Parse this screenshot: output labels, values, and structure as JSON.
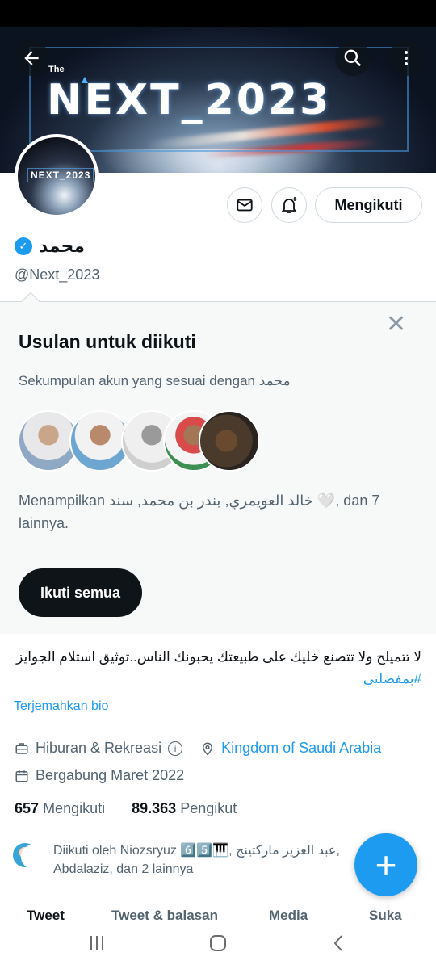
{
  "banner": {
    "small_text": "The",
    "brand_text": "NEXT_2023"
  },
  "avatar": {
    "text": "NEXT_2023"
  },
  "header": {
    "back_icon": "arrow-left-icon",
    "search_icon": "search-icon",
    "more_icon": "more-vertical-icon"
  },
  "actions": {
    "follow_label": "Mengikuti"
  },
  "profile": {
    "name": "محمد",
    "handle": "@Next_2023"
  },
  "suggestions": {
    "title": "Usulan untuk diikuti",
    "subtitle": "Sekumpulan akun yang sesuai dengan محمد",
    "description": "Menampilkan خالد العويمري, بندر بن محمد, سند 🤍, dan 7 lainnya.",
    "follow_all_label": "Ikuti semua"
  },
  "bio": {
    "text": "لا تتميلح ولا تتصنع خليك على طبيعتك يحبونك الناس..توثيق استلام الجوايز ",
    "hashtag": "#بمفضلتي",
    "translate_label": "Terjemahkan bio"
  },
  "meta": {
    "category": "Hiburan & Rekreasi",
    "location": "Kingdom of Saudi Arabia",
    "joined": "Bergabung Maret 2022"
  },
  "stats": {
    "following_count": "657",
    "following_label": "Mengikuti",
    "followers_count": "89.363",
    "followers_label": "Pengikut"
  },
  "followed_by": {
    "text": "Diikuti oleh Niozsryuz 6️⃣5️⃣🎹, عبد العزيز مارکتینج, Abdalaziz, dan 2 lainnya"
  },
  "tabs": [
    "Tweet",
    "Tweet & balasan",
    "Media",
    "Suka"
  ],
  "colors": {
    "accent": "#1d9bf0",
    "text": "#0f1419",
    "muted": "#536471"
  }
}
